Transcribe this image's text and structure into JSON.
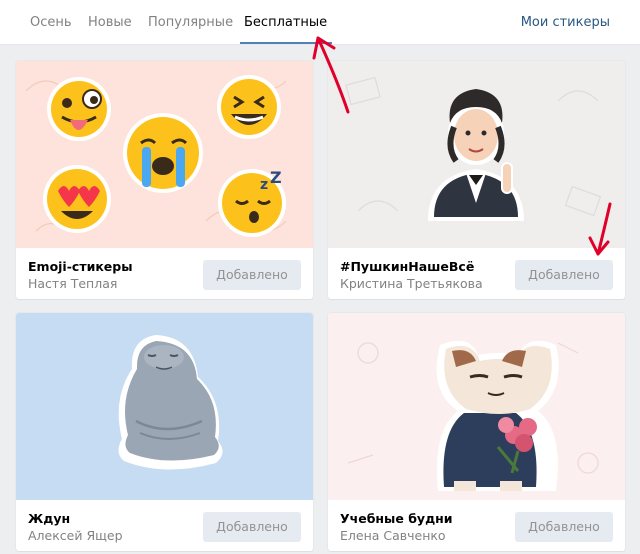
{
  "tabs": [
    {
      "label": "Осень"
    },
    {
      "label": "Новые"
    },
    {
      "label": "Популярные"
    },
    {
      "label": "Бесплатные",
      "active": true
    }
  ],
  "my_stickers_label": "Мои стикеры",
  "cards": [
    {
      "title": "Emoji-стикеры",
      "author": "Настя Теплая",
      "button": "Добавлено",
      "art": "emoji-faces"
    },
    {
      "title": "#ПушкинНашеВсё",
      "author": "Кристина Третьякова",
      "button": "Добавлено",
      "art": "pushkin"
    },
    {
      "title": "Ждун",
      "author": "Алексей Ящер",
      "button": "Добавлено",
      "art": "zhdun"
    },
    {
      "title": "Учебные будни",
      "author": "Елена Савченко",
      "button": "Добавлено",
      "art": "cat-with-flowers"
    }
  ],
  "colors": {
    "accent": "#5181b8",
    "link": "#2a5885",
    "annotation_arrow": "#e0002a"
  }
}
